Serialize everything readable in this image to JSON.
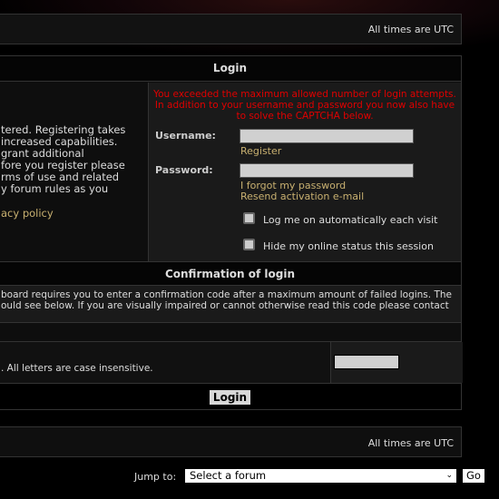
{
  "header_bar": {
    "timezone": "All times are UTC"
  },
  "login": {
    "title": "Login",
    "intro_lines": [
      "tered. Registering takes",
      "increased capabilities.",
      "grant additional",
      "fore you register please",
      "rms of use and related",
      "y forum rules as you"
    ],
    "privacy_link": "acy policy",
    "error": [
      "You exceeded the maximum allowed number of login attempts.",
      "In addition to your username and password you now also have",
      "to solve the CAPTCHA below."
    ],
    "username_label": "Username:",
    "username_value": "",
    "register_link": "Register",
    "password_label": "Password:",
    "password_value": "",
    "forgot_link": "I forgot my password",
    "resend_link": "Resend activation e-mail",
    "autologin_label": "Log me on automatically each visit",
    "autologin_checked": false,
    "hidden_label": "Hide my online status this session",
    "hidden_checked": false
  },
  "confirmation": {
    "title": "Confirmation of login",
    "text_lines": [
      "board requires you to enter a confirmation code after a maximum amount of failed logins. The",
      "ould see below. If you are visually impaired or cannot otherwise read this code please contact"
    ],
    "case_note": ". All letters are case insensitive.",
    "code_value": "",
    "login_button": "Login"
  },
  "footer_bar": {
    "timezone": "All times are UTC"
  },
  "jump": {
    "label": "Jump to:",
    "selected": "Select a forum",
    "go": "Go"
  }
}
